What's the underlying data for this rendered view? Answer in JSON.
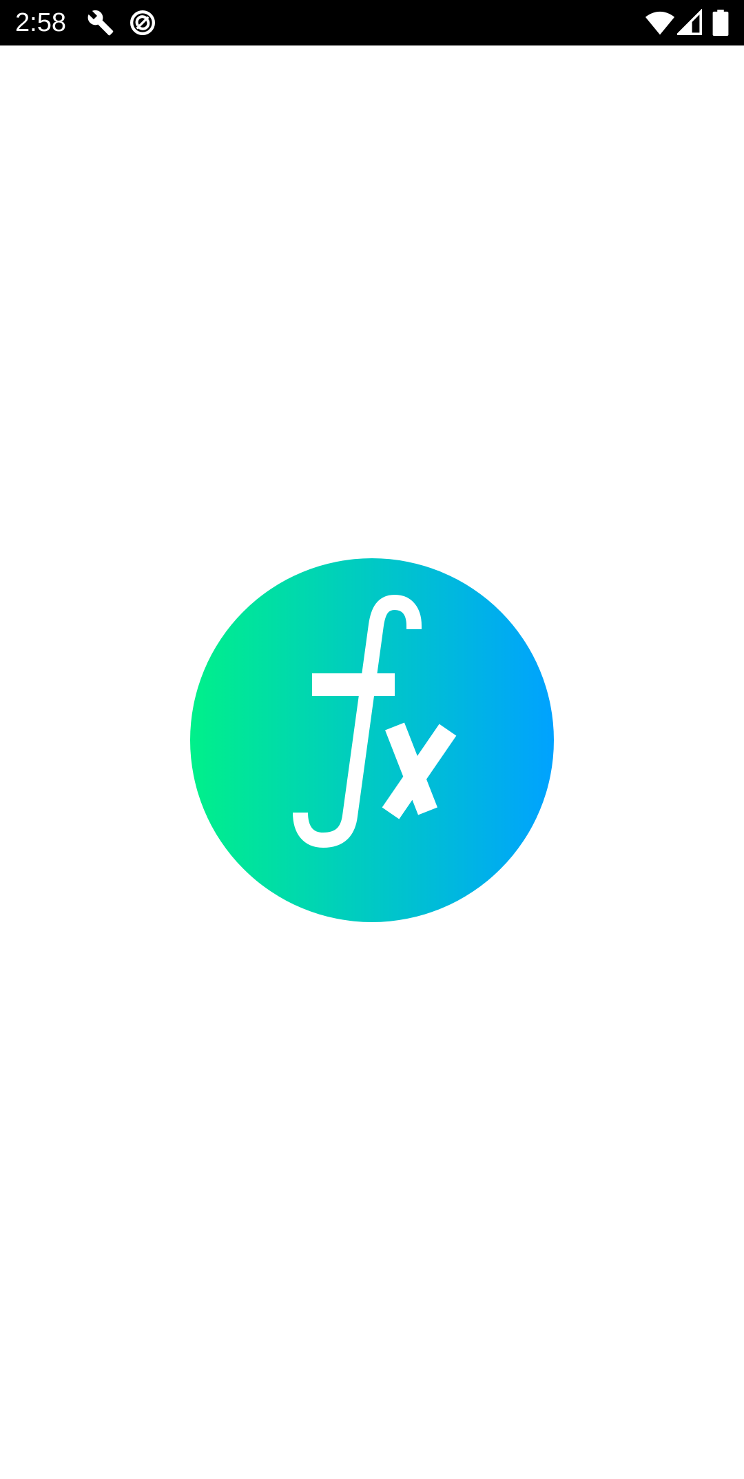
{
  "status_bar": {
    "time": "2:58",
    "background_color": "#000000",
    "icons": {
      "left": [
        "wrench-icon",
        "sync-icon"
      ],
      "right": [
        "wifi-icon",
        "cellular-signal-icon",
        "battery-icon"
      ]
    }
  },
  "splash": {
    "logo_icon": "fx-function-logo-icon",
    "gradient": {
      "start_color": "#00F08A",
      "end_color": "#00A2FF"
    },
    "glyph_color": "#FFFFFF"
  },
  "background_color": "#FFFFFF"
}
